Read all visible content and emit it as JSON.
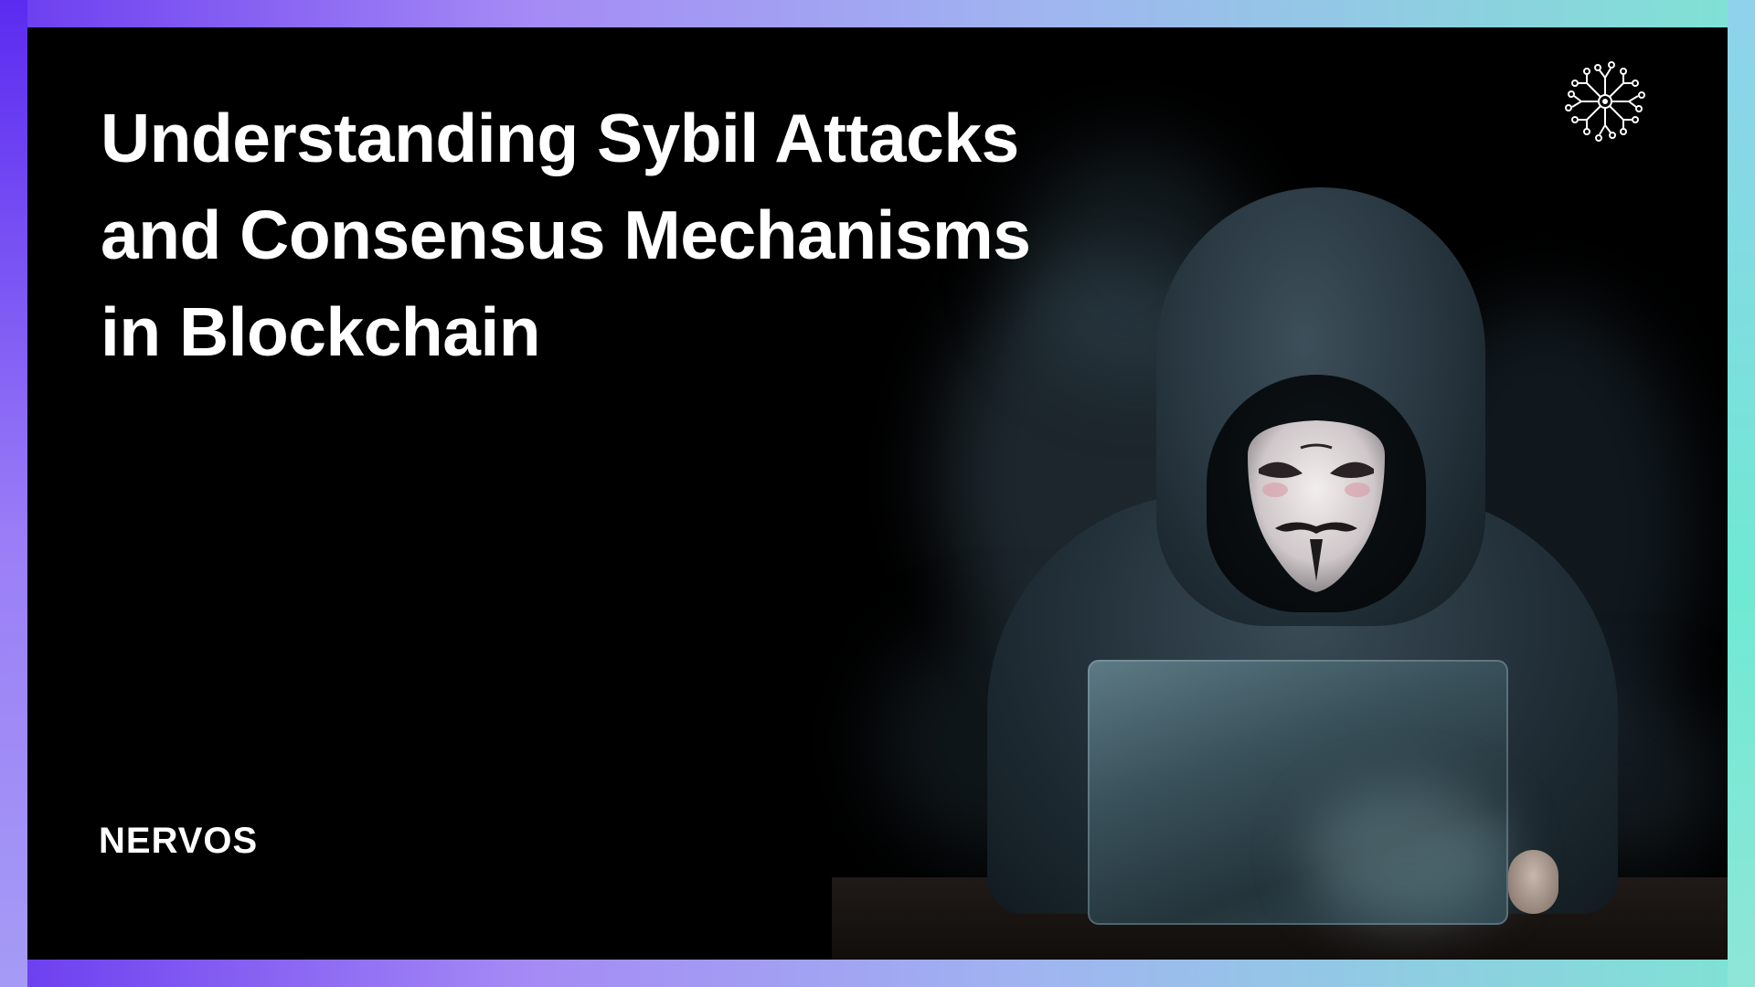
{
  "title": {
    "line1": "Understanding Sybil Attacks",
    "line2": "and Consensus Mechanisms",
    "line3": "in Blockchain"
  },
  "brand": {
    "name": "NERVOS"
  },
  "icons": {
    "top_right": "network-node-icon"
  },
  "colors": {
    "background": "#000000",
    "text": "#ffffff",
    "frame_gradient_start": "#6b3cf0",
    "frame_gradient_end": "#7fe3d4"
  }
}
